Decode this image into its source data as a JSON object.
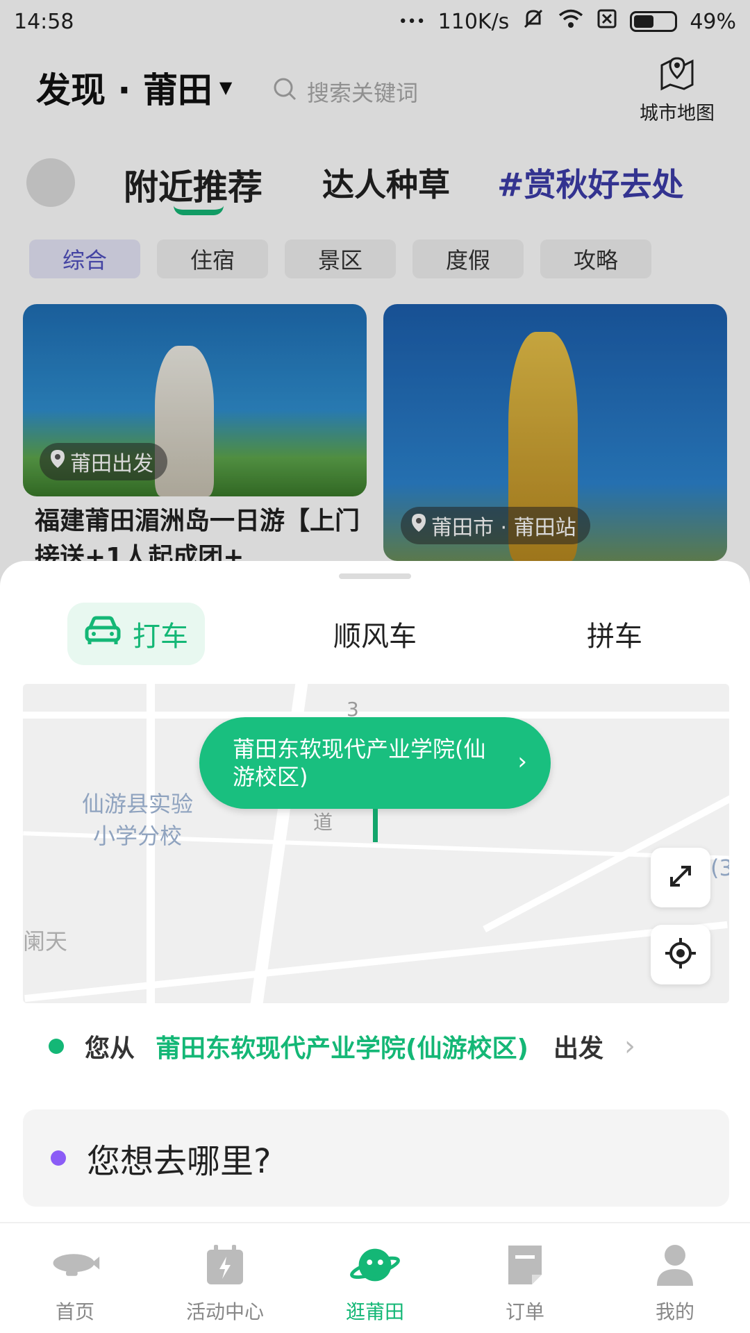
{
  "status_bar": {
    "time": "14:58",
    "dots": "•••",
    "network_speed": "110K/s",
    "battery_percent": "49%",
    "battery_level": 0.49
  },
  "header": {
    "city_title": "发现 · 莆田",
    "search_placeholder": "搜索关键词",
    "city_map_label": "城市地图"
  },
  "feed_tabs": [
    {
      "label": "附近推荐",
      "active": true
    },
    {
      "label": "达人种草",
      "active": false
    },
    {
      "label": "#赏秋好去处",
      "active": false
    }
  ],
  "chips": [
    {
      "label": "综合",
      "active": true
    },
    {
      "label": "住宿",
      "active": false
    },
    {
      "label": "景区",
      "active": false
    },
    {
      "label": "度假",
      "active": false
    },
    {
      "label": "攻略",
      "active": false
    }
  ],
  "cards": [
    {
      "location": "莆田出发",
      "title": "福建莆田湄洲岛一日游【上门接送+1人起成团+"
    },
    {
      "location": "莆田市 · 莆田站"
    }
  ],
  "ride_sheet": {
    "tabs": [
      "打车",
      "顺风车",
      "拼车"
    ],
    "active_tab": "打车",
    "map": {
      "pickup_bubble": "莆田东软现代产业学院(仙游校区)",
      "label_school": "仙游县实验\n小学分校",
      "label_bottom_left": "阑天",
      "label_road_num": "3",
      "label_road_char": "道",
      "label_right_edge": "(3"
    },
    "from": {
      "prefix": "您从",
      "place": "莆田东软现代产业学院(仙游校区)",
      "suffix": "出发",
      "dot_color": "#14b776"
    },
    "destination": {
      "placeholder": "您想去哪里?",
      "dot_color": "#8b5cf6"
    }
  },
  "bottom_nav": [
    {
      "label": "首页",
      "icon": "blimp-icon",
      "active": false
    },
    {
      "label": "活动中心",
      "icon": "calendar-flash-icon",
      "active": false
    },
    {
      "label": "逛莆田",
      "icon": "planet-face-icon",
      "active": true
    },
    {
      "label": "订单",
      "icon": "order-doc-icon",
      "active": false
    },
    {
      "label": "我的",
      "icon": "person-icon",
      "active": false
    }
  ],
  "colors": {
    "accent": "#14b776",
    "bubble": "#19bf7f",
    "hashtag": "#3c3caa",
    "purple_dot": "#8b5cf6"
  }
}
